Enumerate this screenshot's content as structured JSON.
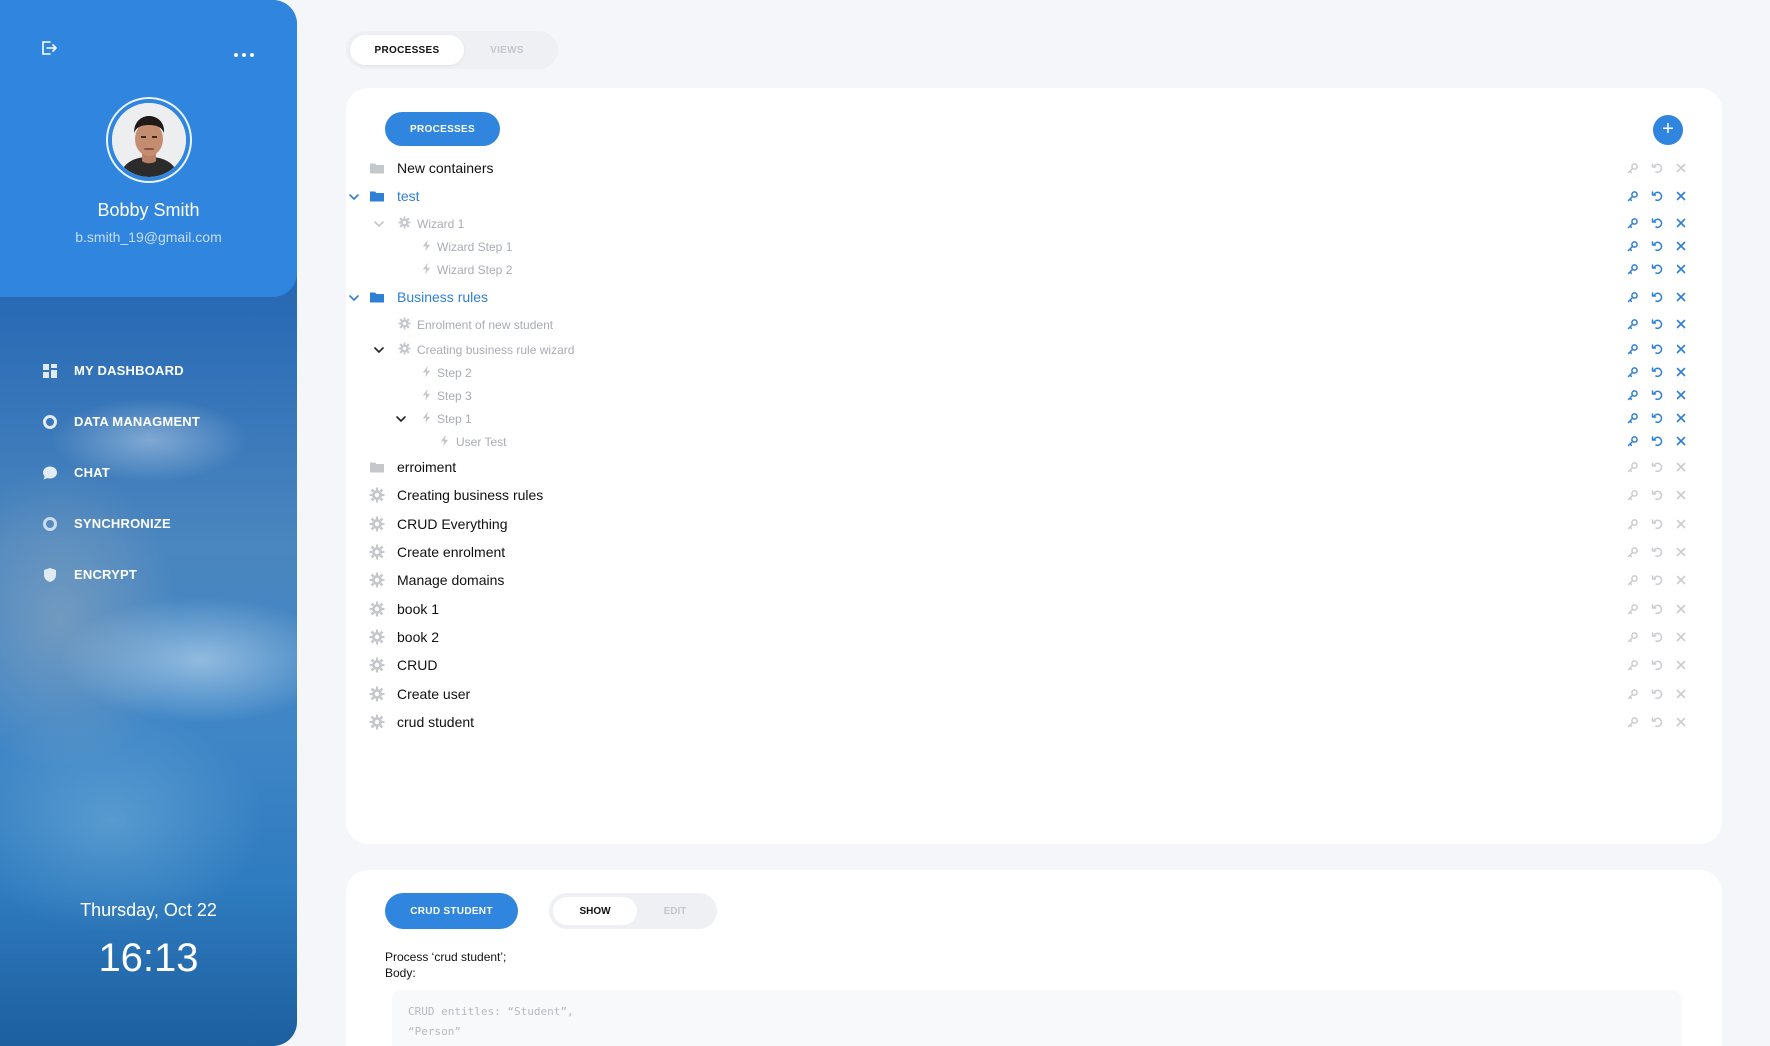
{
  "sidebar": {
    "profile": {
      "name": "Bobby Smith",
      "email": "b.smith_19@gmail.com"
    },
    "nav": [
      {
        "label": "MY DASHBOARD",
        "icon": "grid-icon"
      },
      {
        "label": "DATA MANAGMENT",
        "icon": "pie-chart-icon"
      },
      {
        "label": "CHAT",
        "icon": "chat-bubble-icon"
      },
      {
        "label": "SYNCHRONIZE",
        "icon": "sync-icon"
      },
      {
        "label": "ENCRYPT",
        "icon": "shield-icon"
      }
    ],
    "date": "Thursday, Oct 22",
    "time": "16:13"
  },
  "top_tabs": [
    {
      "label": "PROCESSES",
      "active": true
    },
    {
      "label": "VIEWS",
      "active": false
    }
  ],
  "processes_panel": {
    "title_button": "PROCESSES",
    "add_button": "+",
    "tree": [
      {
        "label": "New containers",
        "icon": "folder-icon",
        "level": 0,
        "kind": "top",
        "active": false
      },
      {
        "label": "test",
        "icon": "folder-icon",
        "level": 0,
        "kind": "top",
        "active": true,
        "expanded": true
      },
      {
        "label": "Wizard 1",
        "icon": "gear-icon",
        "level": 1,
        "kind": "sub",
        "active": true,
        "expanded": true
      },
      {
        "label": "Wizard Step 1",
        "icon": "bolt-icon",
        "level": 2,
        "kind": "sub",
        "active": true
      },
      {
        "label": "Wizard Step 2",
        "icon": "bolt-icon",
        "level": 2,
        "kind": "sub",
        "active": true
      },
      {
        "label": "Business rules",
        "icon": "folder-icon",
        "level": 0,
        "kind": "top",
        "active": true,
        "expanded": true
      },
      {
        "label": "Enrolment of new student",
        "icon": "gear-icon",
        "level": 1,
        "kind": "sub",
        "active": true
      },
      {
        "label": "Creating business rule wizard",
        "icon": "gear-icon",
        "level": 1,
        "kind": "sub",
        "active": true,
        "expanded": true
      },
      {
        "label": "Step 2",
        "icon": "bolt-icon",
        "level": 2,
        "kind": "sub",
        "active": true
      },
      {
        "label": "Step 3",
        "icon": "bolt-icon",
        "level": 2,
        "kind": "sub",
        "active": true
      },
      {
        "label": "Step 1",
        "icon": "bolt-icon",
        "level": 2,
        "kind": "sub",
        "active": true,
        "expanded": true
      },
      {
        "label": "User Test",
        "icon": "bolt-icon",
        "level": 3,
        "kind": "sub",
        "active": true
      },
      {
        "label": "erroiment",
        "icon": "folder-icon",
        "level": 0,
        "kind": "top",
        "active": false
      },
      {
        "label": "Creating business rules",
        "icon": "gear-icon",
        "level": 0,
        "kind": "top",
        "active": false
      },
      {
        "label": "CRUD Everything",
        "icon": "gear-icon",
        "level": 0,
        "kind": "top",
        "active": false
      },
      {
        "label": "Create enrolment",
        "icon": "gear-icon",
        "level": 0,
        "kind": "top",
        "active": false
      },
      {
        "label": "Manage domains",
        "icon": "gear-icon",
        "level": 0,
        "kind": "top",
        "active": false
      },
      {
        "label": "book 1",
        "icon": "gear-icon",
        "level": 0,
        "kind": "top",
        "active": false
      },
      {
        "label": "book 2",
        "icon": "gear-icon",
        "level": 0,
        "kind": "top",
        "active": false
      },
      {
        "label": "CRUD",
        "icon": "gear-icon",
        "level": 0,
        "kind": "top",
        "active": false
      },
      {
        "label": "Create user",
        "icon": "gear-icon",
        "level": 0,
        "kind": "top",
        "active": false
      },
      {
        "label": "crud student",
        "icon": "gear-icon",
        "level": 0,
        "kind": "top",
        "active": false
      }
    ],
    "row_actions": [
      "key-icon",
      "undo-icon",
      "close-icon"
    ]
  },
  "detail_panel": {
    "title_button": "CRUD STUDENT",
    "toggles": [
      {
        "label": "SHOW",
        "active": true
      },
      {
        "label": "EDIT",
        "active": false
      }
    ],
    "description_line1": "Process ‘crud student’;",
    "description_line2": "Body:",
    "code_line1": "CRUD entitles: “Student”,",
    "code_line2": "“Person”"
  },
  "colors": {
    "accent": "#3085de",
    "active_text": "#2e7fd6",
    "muted": "#a8acb3"
  }
}
